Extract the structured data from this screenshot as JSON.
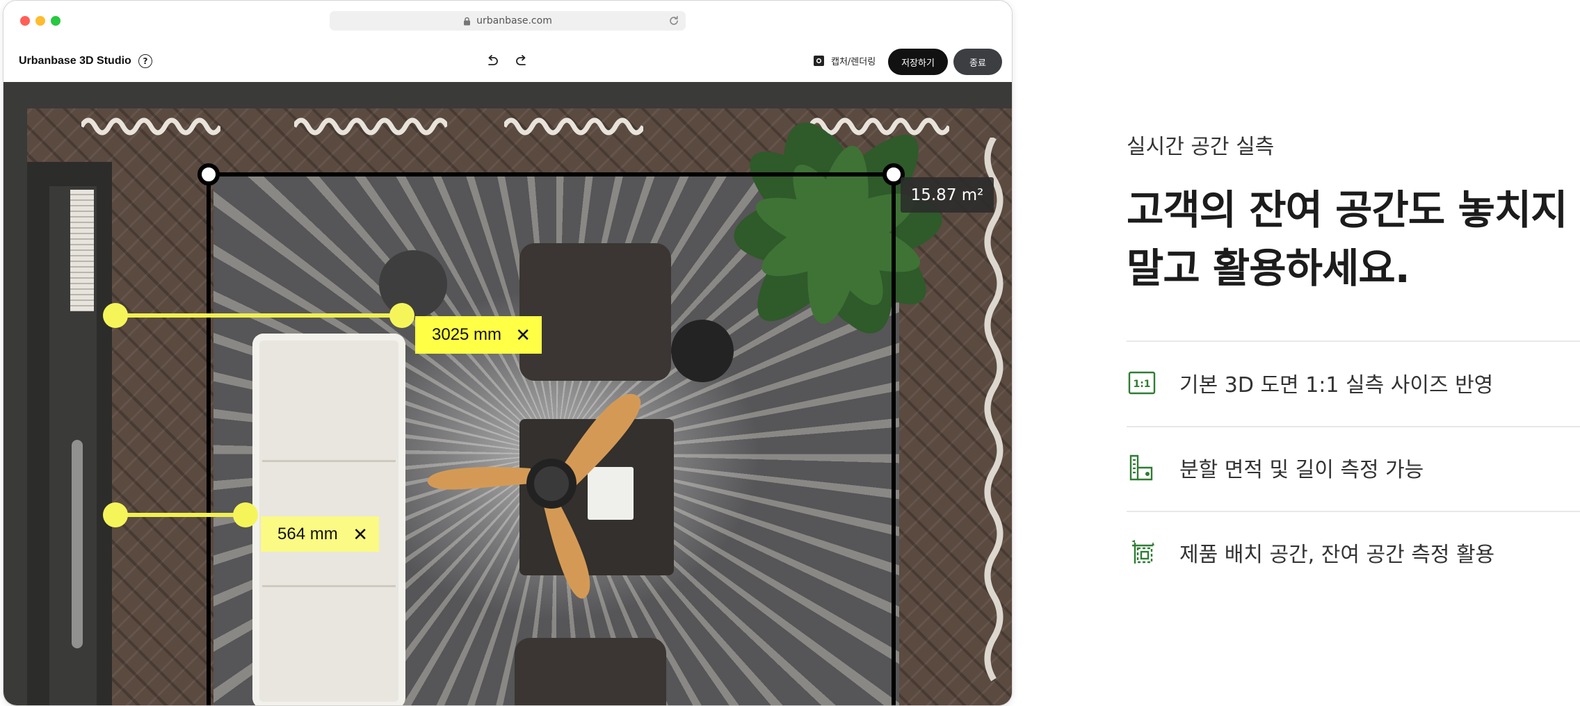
{
  "browser": {
    "url": "urbanbase.com"
  },
  "appbar": {
    "title": "Urbanbase 3D Studio",
    "help_label": "?",
    "capture_label": "캡처/렌더링",
    "save_label": "저장하기",
    "exit_label": "종료"
  },
  "canvas": {
    "area_label": "15.87 m²",
    "measurements": [
      {
        "value": "3025 mm",
        "close": "✕"
      },
      {
        "value": "564 mm",
        "close": "✕"
      }
    ]
  },
  "panel": {
    "kicker": "실시간 공간 실측",
    "headline": [
      "고객의 잔여 공간도 놓치지",
      "말고 활용하세요."
    ],
    "features": [
      {
        "icon": "ratio-1-1-icon",
        "text": "기본 3D 도면 1:1 실측 사이즈 반영"
      },
      {
        "icon": "floorplan-measure-icon",
        "text": "분할 면적 및 길이 측정 가능"
      },
      {
        "icon": "space-measure-icon",
        "text": "제품 배치 공간, 잔여 공간 측정 활용"
      }
    ],
    "accent_color": "#2e7d32"
  },
  "colors": {
    "measure_yellow": "#ffff46",
    "measure_line": "#f0f050",
    "button_dark": "#111111",
    "button_grey": "#3d3e42"
  }
}
